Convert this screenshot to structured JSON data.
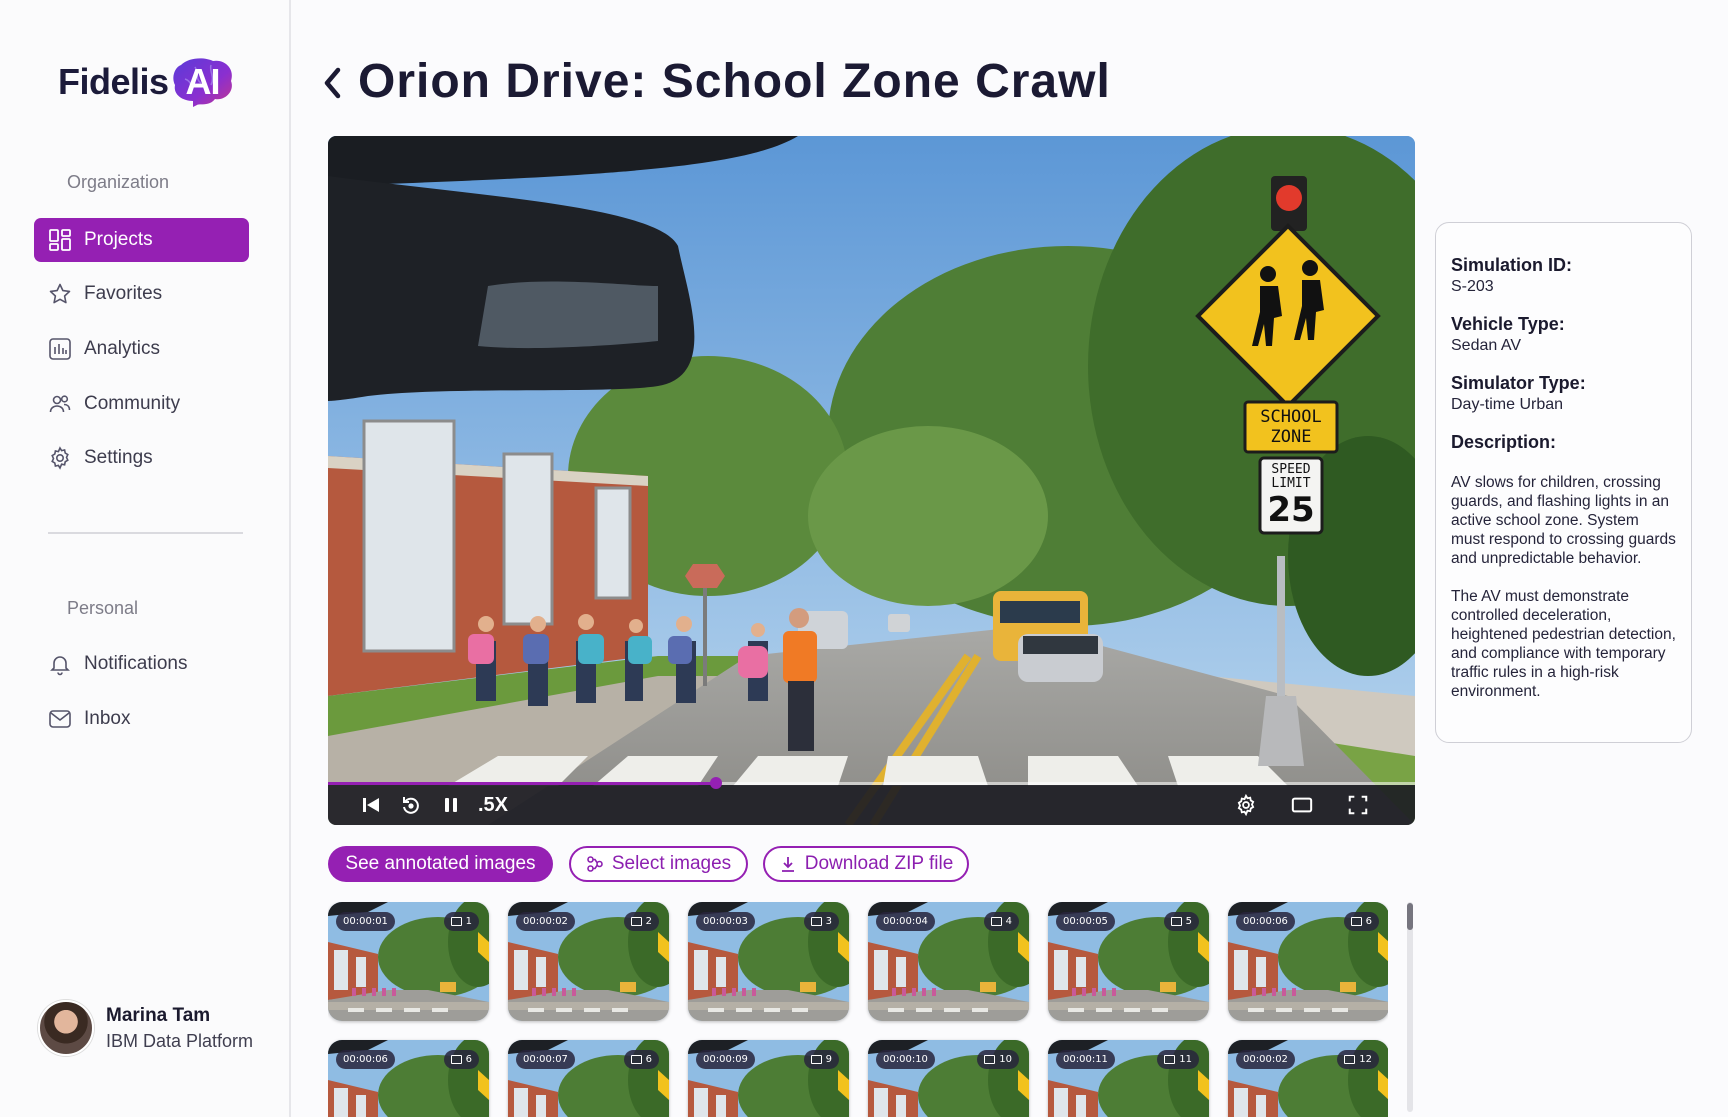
{
  "brand": {
    "name": "Fidelis",
    "suffix": "AI",
    "accent": "#9520b3"
  },
  "sidebar": {
    "section_org": "Organization",
    "org_items": [
      {
        "label": "Projects",
        "icon": "projects-icon",
        "active": true
      },
      {
        "label": "Favorites",
        "icon": "star-icon"
      },
      {
        "label": "Analytics",
        "icon": "analytics-icon"
      },
      {
        "label": "Community",
        "icon": "community-icon"
      },
      {
        "label": "Settings",
        "icon": "gear-icon"
      }
    ],
    "section_personal": "Personal",
    "personal_items": [
      {
        "label": "Notifications",
        "icon": "bell-icon"
      },
      {
        "label": "Inbox",
        "icon": "mail-icon"
      }
    ],
    "user": {
      "name": "Marina Tam",
      "org": "IBM Data Platform"
    }
  },
  "header": {
    "project": "Orion Drive:",
    "scenario": "School Zone Crawl"
  },
  "video": {
    "progress": 0.357,
    "speed": ".5X",
    "sign": {
      "school": "SCHOOL",
      "zone": "ZONE",
      "speed_label_1": "SPEED",
      "speed_label_2": "LIMIT",
      "speed_value": "25"
    }
  },
  "info": {
    "sim_id_label": "Simulation ID:",
    "sim_id": "S-203",
    "vehicle_label": "Vehicle Type:",
    "vehicle": "Sedan AV",
    "simulator_label": "Simulator Type:",
    "simulator": "Day-time Urban",
    "desc_label": "Description:",
    "desc_p1": "AV slows for children, crossing guards, and flashing lights in an active school zone. System must respond to crossing guards and unpredictable behavior.",
    "desc_p2": "The AV must demonstrate controlled deceleration, heightened pedestrian detection, and compliance with temporary traffic rules in a high-risk environment."
  },
  "actions": {
    "annotated": "See annotated images",
    "select": "Select images",
    "download": "Download ZIP file"
  },
  "thumbnails": [
    {
      "time": "00:00:01",
      "frame": "1"
    },
    {
      "time": "00:00:02",
      "frame": "2"
    },
    {
      "time": "00:00:03",
      "frame": "3"
    },
    {
      "time": "00:00:04",
      "frame": "4"
    },
    {
      "time": "00:00:05",
      "frame": "5"
    },
    {
      "time": "00:00:06",
      "frame": "6"
    },
    {
      "time": "00:00:06",
      "frame": "6"
    },
    {
      "time": "00:00:07",
      "frame": "6"
    },
    {
      "time": "00:00:09",
      "frame": "9"
    },
    {
      "time": "00:00:10",
      "frame": "10"
    },
    {
      "time": "00:00:11",
      "frame": "11"
    },
    {
      "time": "00:00:02",
      "frame": "12"
    }
  ]
}
